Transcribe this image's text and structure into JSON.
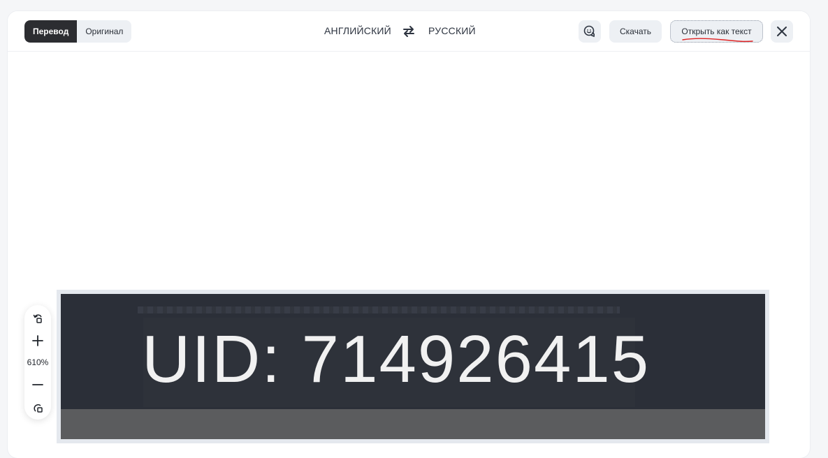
{
  "header": {
    "mode_tabs": [
      {
        "label": "Перевод",
        "active": true
      },
      {
        "label": "Оригинал",
        "active": false
      }
    ],
    "source_language": "АНГЛИЙСКИЙ",
    "target_language": "РУССКИЙ",
    "swap_icon": "swap-arrows-icon",
    "feedback_icon": "face-feedback-icon",
    "download_label": "Скачать",
    "open_as_text_label": "Открыть как текст",
    "close_icon": "close-icon"
  },
  "zoom": {
    "level": "610%",
    "rotate_icon": "rotate-icon",
    "zoom_in_icon": "plus-icon",
    "zoom_out_icon": "minus-icon",
    "fit_icon": "fit-screen-icon"
  },
  "image": {
    "text": "UID: 714926415"
  },
  "colors": {
    "accent_dark": "#2c2d31",
    "button_bg": "#edf0f4",
    "annotation_red": "#e02424",
    "image_bg": "#2b2f38"
  }
}
